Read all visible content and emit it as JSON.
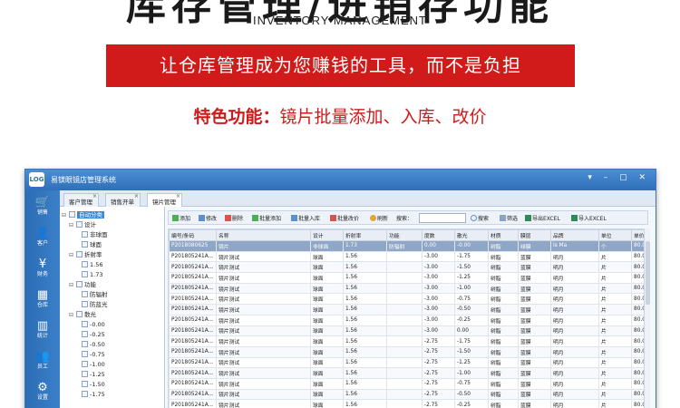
{
  "promo": {
    "title": "库存管理/进销存功能",
    "subtitle": "INVENTORY MANAGEMENT",
    "banner": "让仓库管理成为您赚钱的工具，而不是负担",
    "feature_label": "特色功能：",
    "feature_text": "镜片批量添加、入库、改价"
  },
  "app": {
    "logo": "LOG",
    "title": "易镁眼镜店管理系统",
    "controls": "▾ – ▢ ✕",
    "sidebar": [
      {
        "icon": "🛒",
        "label": "销售"
      },
      {
        "icon": "👤",
        "label": "客户"
      },
      {
        "icon": "¥",
        "label": "财务"
      },
      {
        "icon": "▦",
        "label": "仓库"
      },
      {
        "icon": "▥",
        "label": "统计"
      },
      {
        "icon": "👥",
        "label": "员工"
      },
      {
        "icon": "⚙",
        "label": "设置"
      }
    ],
    "tabs": [
      {
        "label": "客户管理",
        "close": "×"
      },
      {
        "label": "销售开单",
        "close": "×"
      },
      {
        "label": "镜片管理",
        "close": "×"
      }
    ],
    "tree": {
      "root": "自动分类",
      "toggle_open": "⊟",
      "nodes": [
        {
          "label": "设计",
          "level": 1
        },
        {
          "label": "非球面",
          "level": 2
        },
        {
          "label": "球面",
          "level": 2
        },
        {
          "label": "折射率",
          "level": 1
        },
        {
          "label": "1.56",
          "level": 2
        },
        {
          "label": "1.73",
          "level": 2
        },
        {
          "label": "功能",
          "level": 1
        },
        {
          "label": "防辐射",
          "level": 2
        },
        {
          "label": "防蓝光",
          "level": 2
        },
        {
          "label": "散光",
          "level": 1
        },
        {
          "label": "-0.00",
          "level": 2
        },
        {
          "label": "-0.25",
          "level": 2
        },
        {
          "label": "-0.50",
          "level": 2
        },
        {
          "label": "-0.75",
          "level": 2
        },
        {
          "label": "-1.00",
          "level": 2
        },
        {
          "label": "-1.25",
          "level": 2
        },
        {
          "label": "-1.50",
          "level": 2
        },
        {
          "label": "-1.75",
          "level": 2
        }
      ]
    },
    "toolbar": {
      "add": "添加",
      "edit": "修改",
      "delete": "删除",
      "batch_add": "批量添加",
      "batch_in": "批量入库",
      "batch_price": "批量改价",
      "refresh": "刷新",
      "search_label": "搜索：",
      "search_value": "",
      "search_btn": "搜索",
      "filter": "筛选",
      "export": "导出EXCEL",
      "import": "导入EXCEL"
    },
    "grid": {
      "columns": [
        "编号/条码",
        "名称",
        "设计",
        "折射率",
        "功能",
        "度数",
        "散光",
        "材质",
        "膜层",
        "品牌",
        "单位",
        "单价"
      ],
      "rows": [
        [
          "P2018080625",
          "镜片",
          "非球面",
          "1.73",
          "防辐射",
          "0.00",
          "-0.00",
          "树脂",
          "绿膜",
          "Is Ma",
          "个",
          "80.0"
        ],
        [
          "P201805241A...",
          "镜片测试",
          "球面",
          "1.56",
          "",
          "-3.00",
          "-1.75",
          "树脂",
          "蓝膜",
          "明月",
          "片",
          "80.0"
        ],
        [
          "P201805241A...",
          "镜片测试",
          "球面",
          "1.56",
          "",
          "-3.00",
          "-1.50",
          "树脂",
          "蓝膜",
          "明月",
          "片",
          "80.0"
        ],
        [
          "P201805241A...",
          "镜片测试",
          "球面",
          "1.56",
          "",
          "-3.00",
          "-1.25",
          "树脂",
          "蓝膜",
          "明月",
          "片",
          "80.0"
        ],
        [
          "P201805241A...",
          "镜片测试",
          "球面",
          "1.56",
          "",
          "-3.00",
          "-1.00",
          "树脂",
          "蓝膜",
          "明月",
          "片",
          "80.0"
        ],
        [
          "P201805241A...",
          "镜片测试",
          "球面",
          "1.56",
          "",
          "-3.00",
          "-0.75",
          "树脂",
          "蓝膜",
          "明月",
          "片",
          "80.0"
        ],
        [
          "P201805241A...",
          "镜片测试",
          "球面",
          "1.56",
          "",
          "-3.00",
          "-0.50",
          "树脂",
          "蓝膜",
          "明月",
          "片",
          "80.0"
        ],
        [
          "P201805241A...",
          "镜片测试",
          "球面",
          "1.56",
          "",
          "-3.00",
          "-0.25",
          "树脂",
          "蓝膜",
          "明月",
          "片",
          "80.0"
        ],
        [
          "P201805241A...",
          "镜片测试",
          "球面",
          "1.56",
          "",
          "-3.00",
          "0.00",
          "树脂",
          "蓝膜",
          "明月",
          "片",
          "80.0"
        ],
        [
          "P201805241A...",
          "镜片测试",
          "球面",
          "1.56",
          "",
          "-2.75",
          "-1.75",
          "树脂",
          "蓝膜",
          "明月",
          "片",
          "80.0"
        ],
        [
          "P201805241A...",
          "镜片测试",
          "球面",
          "1.56",
          "",
          "-2.75",
          "-1.50",
          "树脂",
          "蓝膜",
          "明月",
          "片",
          "80.0"
        ],
        [
          "P201805241A...",
          "镜片测试",
          "球面",
          "1.56",
          "",
          "-2.75",
          "-1.25",
          "树脂",
          "蓝膜",
          "明月",
          "片",
          "80.0"
        ],
        [
          "P201805241A...",
          "镜片测试",
          "球面",
          "1.56",
          "",
          "-2.75",
          "-1.00",
          "树脂",
          "蓝膜",
          "明月",
          "片",
          "80.0"
        ],
        [
          "P201805241A...",
          "镜片测试",
          "球面",
          "1.56",
          "",
          "-2.75",
          "-0.75",
          "树脂",
          "蓝膜",
          "明月",
          "片",
          "80.0"
        ],
        [
          "P201805241A...",
          "镜片测试",
          "球面",
          "1.56",
          "",
          "-2.75",
          "-0.50",
          "树脂",
          "蓝膜",
          "明月",
          "片",
          "80.0"
        ],
        [
          "P201805241A...",
          "镜片测试",
          "球面",
          "1.56",
          "",
          "-2.75",
          "-0.25",
          "树脂",
          "蓝膜",
          "明月",
          "片",
          "80.0"
        ]
      ]
    }
  },
  "colors": {
    "accent_red": "#d11a1a",
    "window_blue": "#2f6fb7",
    "selection": "#3a86d8"
  }
}
